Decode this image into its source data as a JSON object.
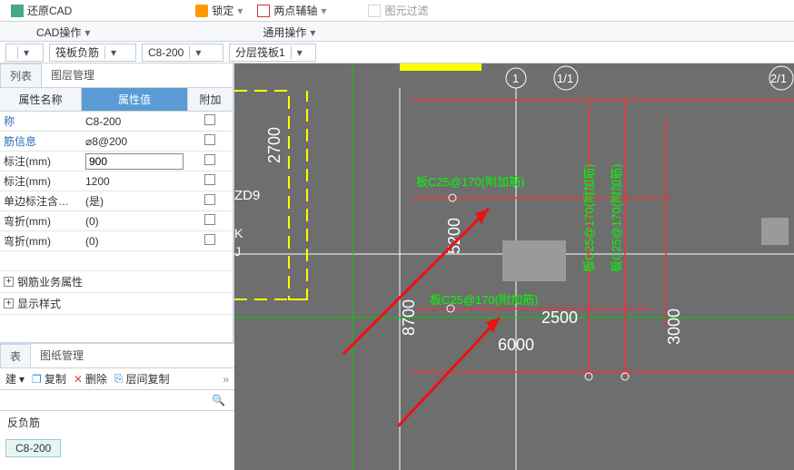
{
  "ribbon": {
    "restore_cad": "还原CAD",
    "lock": "锁定",
    "two_point_axis": "两点辅轴",
    "filter": "图元过滤",
    "cad_ops": "CAD操作",
    "general_ops": "通用操作"
  },
  "selectors": {
    "s1": "",
    "s2": "筏板负筋",
    "s3": "C8-200",
    "s4": "分层筏板1"
  },
  "left": {
    "tab_list": "列表",
    "tab_layer": "图层管理",
    "hdr_name": "属性名称",
    "hdr_val": "属性值",
    "hdr_add": "附加",
    "rows": [
      {
        "name": "称",
        "val": "C8-200",
        "chk": true
      },
      {
        "name": "筋信息",
        "val": "⌀8@200",
        "chk": true
      },
      {
        "name": "标注(mm)",
        "val": "900",
        "edit": true,
        "chk": true
      },
      {
        "name": "标注(mm)",
        "val": "1200",
        "chk": true
      },
      {
        "name": "单边标注含…",
        "val": "(是)",
        "chk": true
      },
      {
        "name": "弯折(mm)",
        "val": "(0)",
        "chk": true
      },
      {
        "name": "弯折(mm)",
        "val": "(0)",
        "chk": true
      }
    ],
    "sec_rebar": "钢筋业务属性",
    "sec_display": "显示样式"
  },
  "lower": {
    "tab_list": "表",
    "tab_paper": "图纸管理",
    "new": "建",
    "copy": "复制",
    "del": "删除",
    "layer_copy": "层间复制",
    "list_label": "反负筋",
    "tag": "C8-200"
  },
  "canvas": {
    "grid1": "1",
    "grid11": "1/1",
    "grid21": "2/1",
    "zd9": "ZD9",
    "k": "K",
    "j": "J",
    "dim2700": "2700",
    "dim5200": "5200",
    "dim8700": "8700",
    "dim2500": "2500",
    "dim6000": "6000",
    "dim3000": "3000",
    "rebar1": "板C25@170(附加筋)",
    "rebar2": "板C25@170(附加筋)",
    "rebar3": "板C25@170(附加筋)",
    "rebar4": "板C25@170(附加筋)"
  }
}
